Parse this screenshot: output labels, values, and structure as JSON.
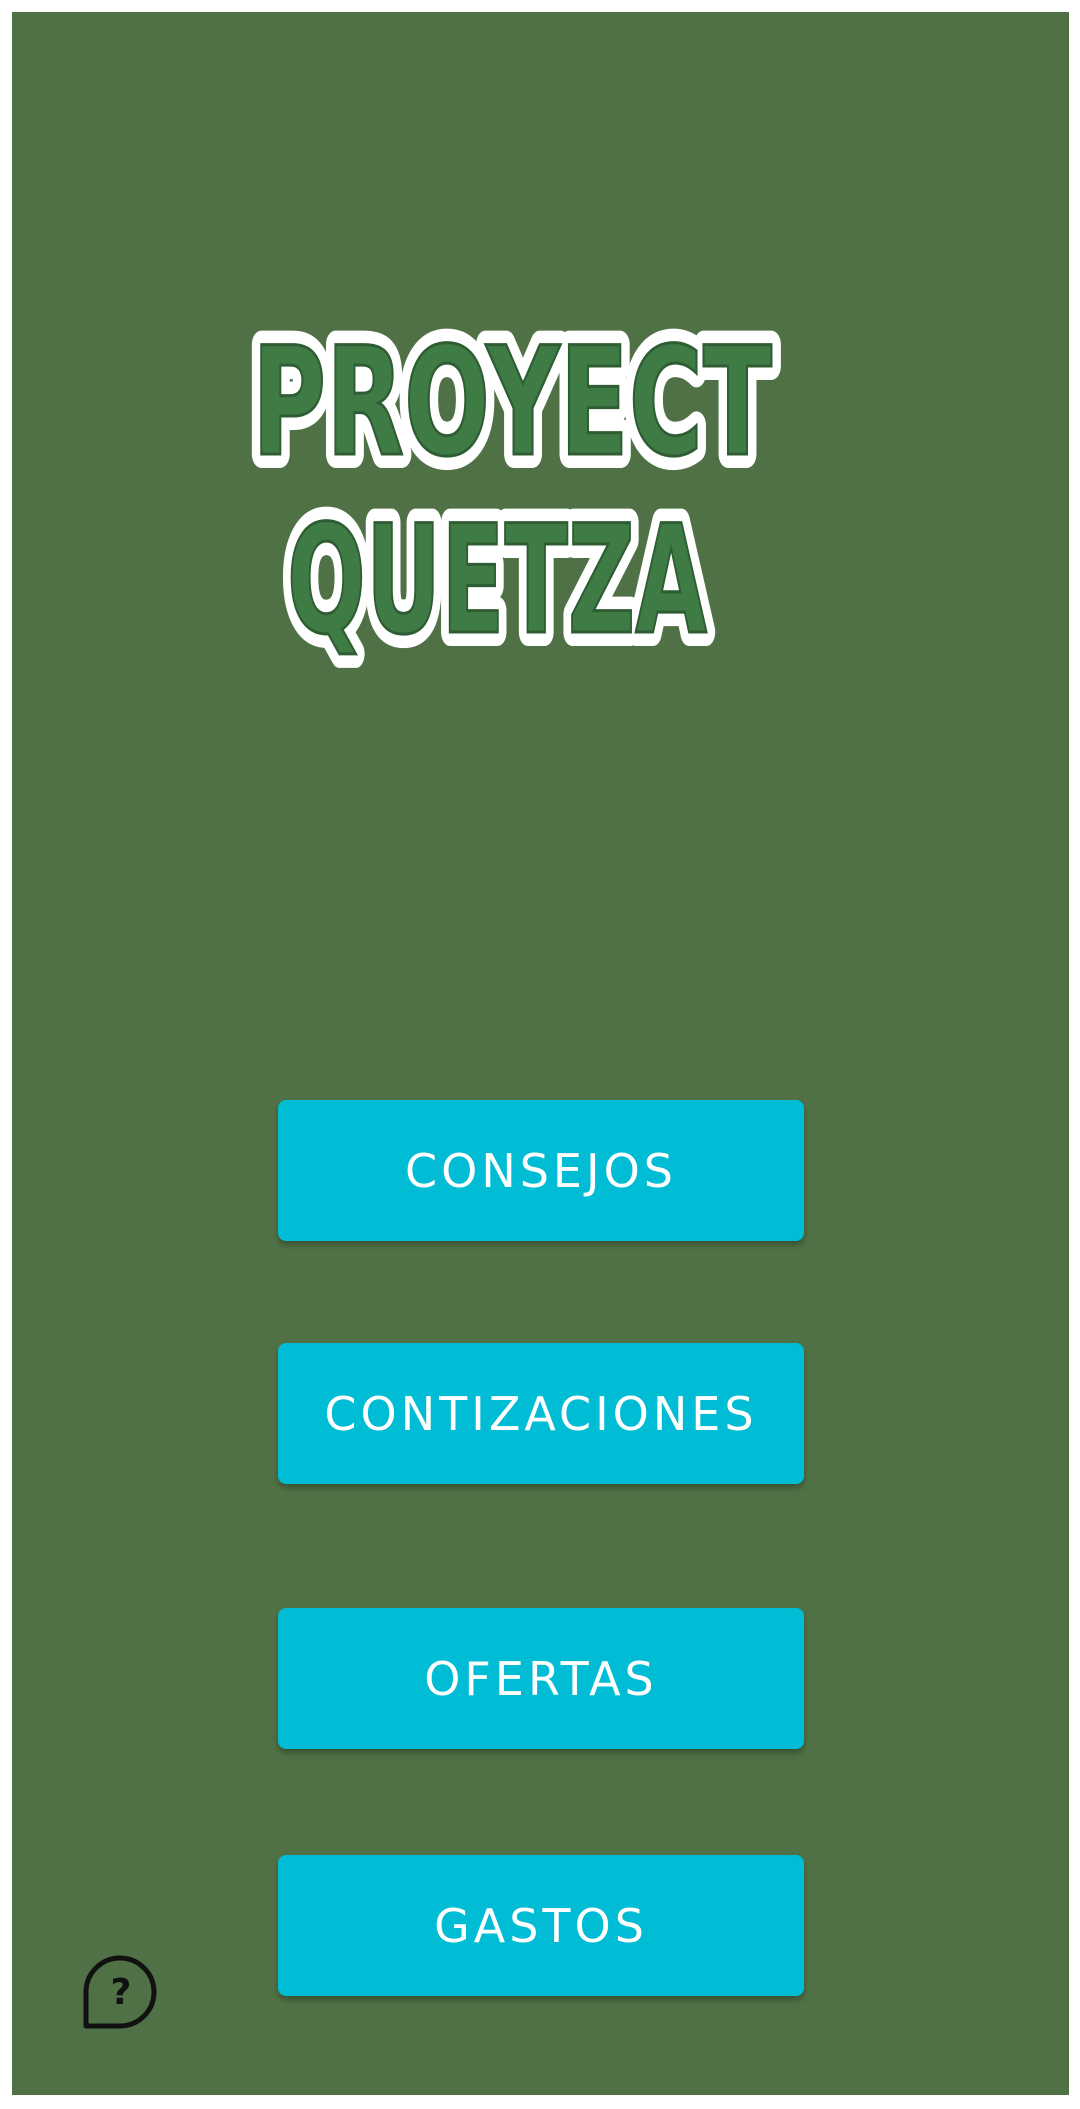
{
  "app": {
    "logo_line1": "PROYECT",
    "logo_line2": "QUETZA"
  },
  "menu": {
    "consejos_label": "CONSEJOS",
    "contizaciones_label": "CONTIZACIONES",
    "ofertas_label": "OFERTAS",
    "gastos_label": "GASTOS"
  },
  "icons": {
    "help": "help-bubble-icon"
  },
  "colors": {
    "background": "#507145",
    "button": "#00bcd4",
    "button_text": "#ffffff",
    "logo_fill": "#3f7b45",
    "logo_outline": "#ffffff"
  }
}
